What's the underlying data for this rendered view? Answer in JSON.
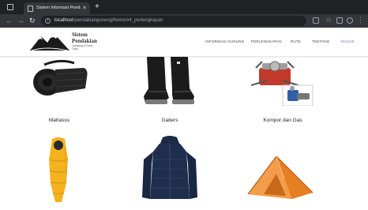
{
  "browser": {
    "tab_title": "Sistem Informasi Pendakian Gu...",
    "tab_close": "×",
    "new_tab": "+",
    "url_host": "localhost",
    "url_path": "/pendakiangunung/home/v4_perlengkapan",
    "info_glyph": "i",
    "star_glyph": "☆",
    "menu_glyph": "⋮",
    "back_glyph": "←",
    "forward_glyph": "→",
    "reload_glyph": "↻"
  },
  "site": {
    "brand_line1": "Sistem",
    "brand_line2": "Pendakian",
    "brand_tagline_1": "Camping & Gear",
    "brand_tagline_2": "Trips",
    "nav": [
      {
        "label": "INFORMASI GUNUNG"
      },
      {
        "label": "PERLENGKAPAN"
      },
      {
        "label": "RUTE"
      },
      {
        "label": "TENTANG"
      },
      {
        "label": "MASUK"
      }
    ],
    "colors": {
      "accent": "#9b59b6"
    }
  },
  "products": [
    {
      "name": "Matrasss",
      "icon": "sleeping-pad-icon"
    },
    {
      "name": "Gaiters",
      "icon": "gaiters-icon"
    },
    {
      "name": "Kompor dan Gas",
      "icon": "camp-stove-icon"
    },
    {
      "name": "",
      "icon": "sleeping-bag-icon"
    },
    {
      "name": "",
      "icon": "down-jacket-icon"
    },
    {
      "name": "",
      "icon": "tent-icon"
    }
  ]
}
